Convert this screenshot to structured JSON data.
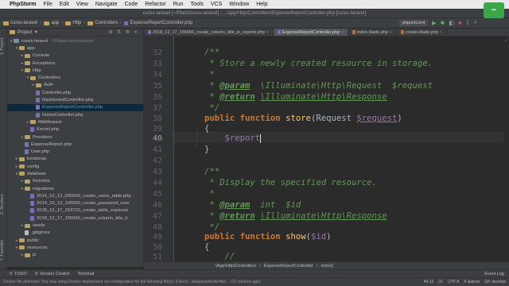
{
  "menubar": {
    "app_name": "PhpStorm",
    "items": [
      "File",
      "Edit",
      "View",
      "Navigate",
      "Code",
      "Refactor",
      "Run",
      "Tools",
      "VCS",
      "Window",
      "Help"
    ]
  },
  "window_title": "cures-laravel [~/Platzi/cures-laravel] - .../app/Http/Controllers/ExpenseReportController.php [cures-laravel]",
  "nav_breadcrumb": [
    "cures-laravel",
    "app",
    "Http",
    "Controllers",
    "ExpenseReportController.php"
  ],
  "toolbar": {
    "run_config": "phpunit.xml"
  },
  "project_panel": {
    "title": "Project",
    "tree": [
      {
        "depth": 0,
        "arrow": "▾",
        "icon": "folderb",
        "label": "cures-laravel",
        "hint": "~/Platzi/cures-laravel"
      },
      {
        "depth": 1,
        "arrow": "▾",
        "icon": "folder",
        "label": "app"
      },
      {
        "depth": 2,
        "arrow": "▸",
        "icon": "folder",
        "label": "Console"
      },
      {
        "depth": 2,
        "arrow": "▸",
        "icon": "folder",
        "label": "Exceptions"
      },
      {
        "depth": 2,
        "arrow": "▾",
        "icon": "folder",
        "label": "Http"
      },
      {
        "depth": 3,
        "arrow": "▾",
        "icon": "folder",
        "label": "Controllers"
      },
      {
        "depth": 4,
        "arrow": "▸",
        "icon": "folder",
        "label": "Auth"
      },
      {
        "depth": 4,
        "arrow": "",
        "icon": "php",
        "label": "Controller.php"
      },
      {
        "depth": 4,
        "arrow": "",
        "icon": "php",
        "label": "DashboardController.php"
      },
      {
        "depth": 4,
        "arrow": "",
        "icon": "php",
        "label": "ExpenseReportController.php",
        "blue": true
      },
      {
        "depth": 4,
        "arrow": "",
        "icon": "php",
        "label": "HomeController.php"
      },
      {
        "depth": 3,
        "arrow": "▸",
        "icon": "folder",
        "label": "Middleware"
      },
      {
        "depth": 3,
        "arrow": "",
        "icon": "php",
        "label": "Kernel.php"
      },
      {
        "depth": 2,
        "arrow": "▸",
        "icon": "folder",
        "label": "Providers"
      },
      {
        "depth": 2,
        "arrow": "",
        "icon": "php",
        "label": "ExpenseReport.php"
      },
      {
        "depth": 2,
        "arrow": "",
        "icon": "php",
        "label": "User.php"
      },
      {
        "depth": 1,
        "arrow": "▸",
        "icon": "folder",
        "label": "bootstrap"
      },
      {
        "depth": 1,
        "arrow": "▸",
        "icon": "folder",
        "label": "config"
      },
      {
        "depth": 1,
        "arrow": "▾",
        "icon": "folder",
        "label": "database"
      },
      {
        "depth": 2,
        "arrow": "▸",
        "icon": "folder",
        "label": "factories"
      },
      {
        "depth": 2,
        "arrow": "▾",
        "icon": "folder",
        "label": "migrations"
      },
      {
        "depth": 3,
        "arrow": "",
        "icon": "php",
        "label": "2014_10_12_000000_create_users_table.php"
      },
      {
        "depth": 3,
        "arrow": "",
        "icon": "php",
        "label": "2014_10_12_100000_create_password_rese"
      },
      {
        "depth": 3,
        "arrow": "",
        "icon": "php",
        "label": "2018_12_17_153720_create_table_expense"
      },
      {
        "depth": 3,
        "arrow": "",
        "icon": "php",
        "label": "2018_12_17_155656_create_column_title_ii"
      },
      {
        "depth": 2,
        "arrow": "▸",
        "icon": "folder",
        "label": "seeds"
      },
      {
        "depth": 2,
        "arrow": "",
        "icon": "file",
        "label": ".gitignore"
      },
      {
        "depth": 1,
        "arrow": "▸",
        "icon": "folder",
        "label": "public"
      },
      {
        "depth": 1,
        "arrow": "▾",
        "icon": "folder",
        "label": "resources"
      },
      {
        "depth": 2,
        "arrow": "▸",
        "icon": "folder",
        "label": "js"
      }
    ]
  },
  "tabs": [
    {
      "label": "2018_12_17_155656_create_column_title_in_reports.php",
      "active": false
    },
    {
      "label": "ExpenseReportController.php",
      "active": true
    },
    {
      "label": "index.blade.php",
      "active": false
    },
    {
      "label": "create.blade.php",
      "active": false
    }
  ],
  "editor": {
    "line_numbers": [
      "32",
      "33",
      "34",
      "35",
      "36",
      "37",
      "38",
      "39",
      "40",
      "41",
      "42",
      "43",
      "44",
      "45",
      "46",
      "47",
      "48",
      "49",
      "50",
      "51"
    ],
    "current_line": "40",
    "typed_text": "$report"
  },
  "code_breadcrumb": [
    "\\App\\Http\\Controllers",
    "ExpenseReportController",
    "store()"
  ],
  "tool_tabs": [
    "6: TODO",
    "9: Version Control",
    "Terminal"
  ],
  "event_log": "Event Log",
  "status": {
    "message": "Docker file detection: You may setup Docker deployment run configuration for the following file(s): /Users/...wkspace/dockerfile/... (10 minutes ago)",
    "position": "40:12",
    "line_sep": "LF",
    "encoding": "UTF-8",
    "indent": "4 spaces",
    "git": "Git: develop"
  },
  "left_strip": [
    "1: Project",
    "2: Structure",
    "7: Favorites"
  ],
  "overlay_badge": "~"
}
